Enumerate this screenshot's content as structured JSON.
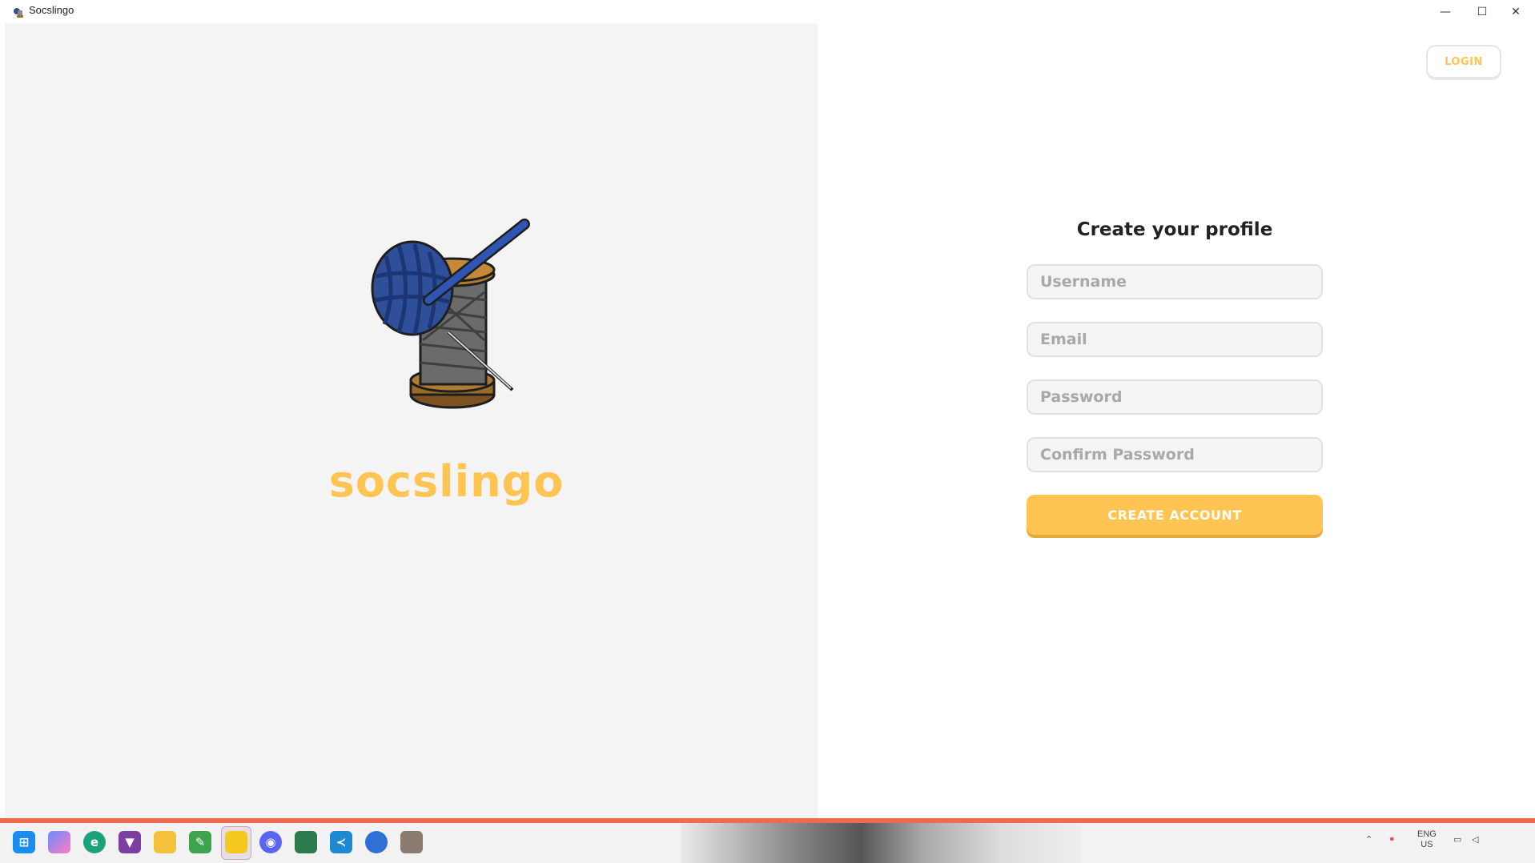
{
  "window": {
    "title": "Socslingo",
    "controls": {
      "minimize": "—",
      "maximize": "☐",
      "close": "✕"
    }
  },
  "brand": {
    "name": "socslingo"
  },
  "header": {
    "login_label": "LOGIN"
  },
  "form": {
    "title": "Create your profile",
    "username_placeholder": "Username",
    "email_placeholder": "Email",
    "password_placeholder": "Password",
    "confirm_password_placeholder": "Confirm Password",
    "create_label": "CREATE ACCOUNT"
  },
  "colors": {
    "accent": "#ffc452",
    "left_bg": "#f4f4f4",
    "yarn_blue": "#2f4f9a",
    "spool_brown": "#9c6b2a",
    "thread_gray": "#6b6b6b",
    "statusbar": "#f06a51"
  },
  "taskbar": {
    "icons": [
      "windows-start-icon",
      "copilot-icon",
      "edge-dev-icon",
      "brave-icon",
      "file-explorer-icon",
      "notepad-icon",
      "sticky-notes-icon",
      "discord-icon",
      "app-icon",
      "vscode-icon",
      "firefox-icon",
      "socslingo-icon"
    ],
    "tray": {
      "lang_top": "ENG",
      "lang_bottom": "US"
    }
  }
}
